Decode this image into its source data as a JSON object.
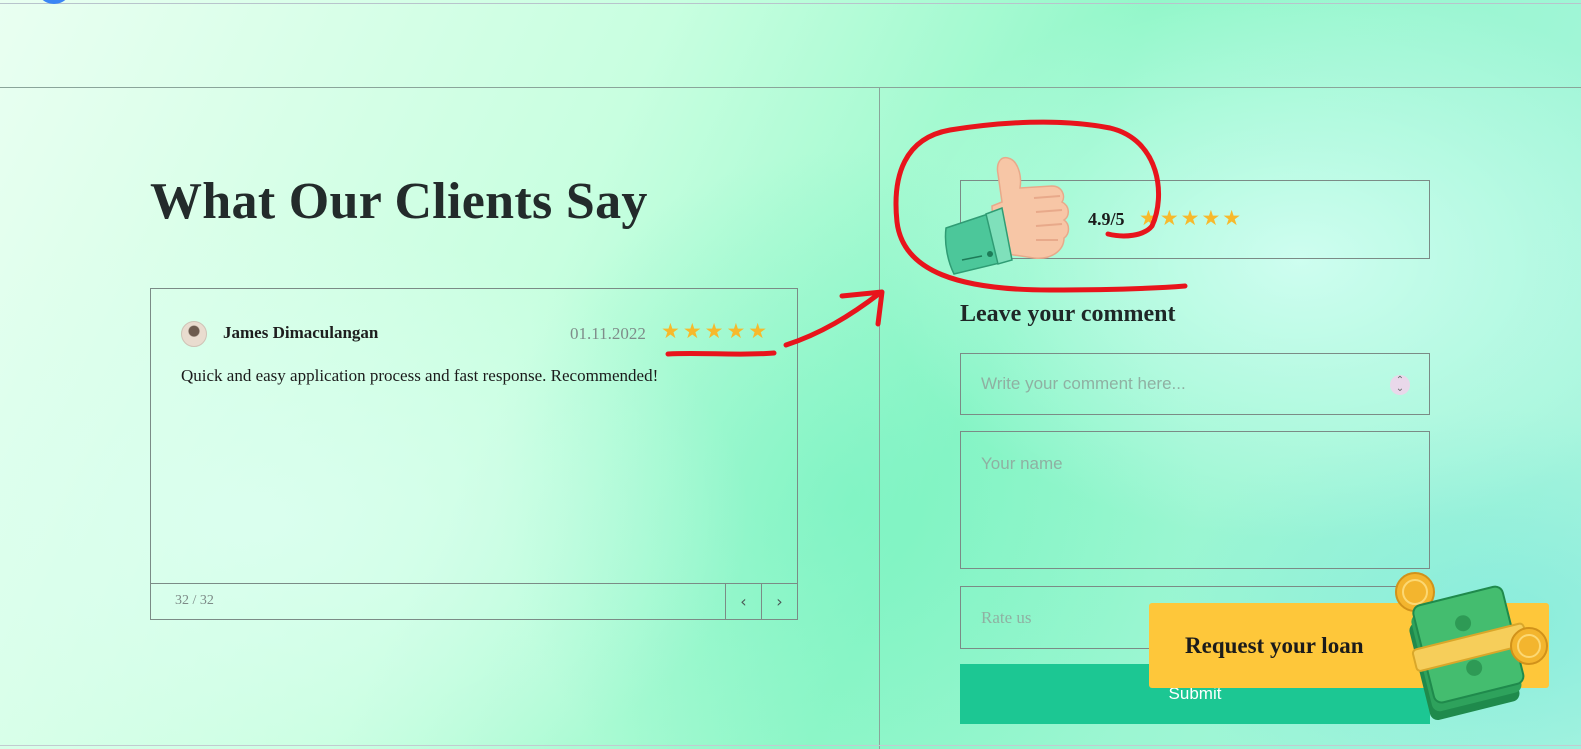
{
  "section": {
    "title": "What Our Clients Say"
  },
  "review": {
    "author": "James Dimaculangan",
    "date": "01.11.2022",
    "stars": "★★★★★",
    "text": "Quick and easy application process and fast response. Recommended!",
    "counter": "32 / 32",
    "prev_icon": "‹",
    "next_icon": "›"
  },
  "rating": {
    "value": "4.9/5",
    "stars": "★★★★★",
    "icon": "thumbs-up-icon"
  },
  "comment_form": {
    "heading": "Leave your comment",
    "comment_placeholder": "Write your comment here...",
    "name_placeholder": "Your name",
    "rate_placeholder": "Rate us",
    "submit_label": "Submit"
  },
  "cta": {
    "label": "Request your loan",
    "icon": "cash-stack-icon"
  },
  "colors": {
    "accent_green": "#1cc793",
    "cta_yellow": "#fec73a",
    "star": "#f7b92b",
    "annotation_red": "#e8141c"
  }
}
